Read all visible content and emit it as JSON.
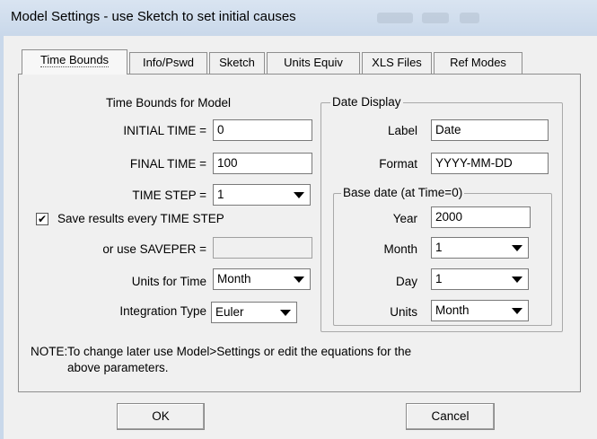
{
  "window": {
    "title": "Model Settings - use Sketch to set initial causes"
  },
  "tabs": [
    {
      "label": "Time Bounds",
      "active": true
    },
    {
      "label": "Info/Pswd"
    },
    {
      "label": "Sketch"
    },
    {
      "label": "Units Equiv"
    },
    {
      "label": "XLS Files"
    },
    {
      "label": "Ref Modes"
    }
  ],
  "time_bounds": {
    "section_title": "Time Bounds for Model",
    "initial_time": {
      "label": "INITIAL TIME =",
      "value": "0"
    },
    "final_time": {
      "label": "FINAL TIME =",
      "value": "100"
    },
    "time_step": {
      "label": "TIME STEP =",
      "value": "1"
    },
    "save_every": {
      "label": "Save results every TIME STEP",
      "checked": true,
      "check_glyph": "✔"
    },
    "saveper": {
      "label": "or use SAVEPER =",
      "value": ""
    },
    "units_for_time": {
      "label": "Units for Time",
      "value": "Month"
    },
    "integration_type": {
      "label": "Integration Type",
      "value": "Euler"
    }
  },
  "date_display": {
    "legend": "Date Display",
    "label": {
      "label": "Label",
      "value": "Date"
    },
    "format": {
      "label": "Format",
      "value": "YYYY-MM-DD"
    },
    "base_date": {
      "legend": "Base date (at Time=0)",
      "year": {
        "label": "Year",
        "value": "2000"
      },
      "month": {
        "label": "Month",
        "value": "1"
      },
      "day": {
        "label": "Day",
        "value": "1"
      },
      "units": {
        "label": "Units",
        "value": "Month"
      }
    }
  },
  "note": {
    "prefix": "NOTE:",
    "line1": "To change later use Model>Settings or edit the equations for the",
    "line2": "above parameters."
  },
  "buttons": {
    "ok": "OK",
    "cancel": "Cancel"
  }
}
